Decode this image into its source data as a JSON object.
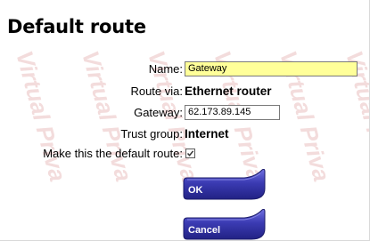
{
  "page": {
    "title": "Default route",
    "watermark_text": "Virtual Priva"
  },
  "form": {
    "name_label": "Name:",
    "name_value": "Gateway",
    "route_via_label": "Route via:",
    "route_via_value": "Ethernet router",
    "gateway_label": "Gateway:",
    "gateway_value": "62.173.89.145",
    "trust_group_label": "Trust group:",
    "trust_group_value": "Internet",
    "default_route_label": "Make this the default route:",
    "default_route_checked": true
  },
  "buttons": {
    "ok_label": "OK",
    "cancel_label": "Cancel"
  },
  "colors": {
    "name_field_bg": "#ffff99",
    "button_blue": "#3a3aa8",
    "watermark": "#f3dede"
  }
}
